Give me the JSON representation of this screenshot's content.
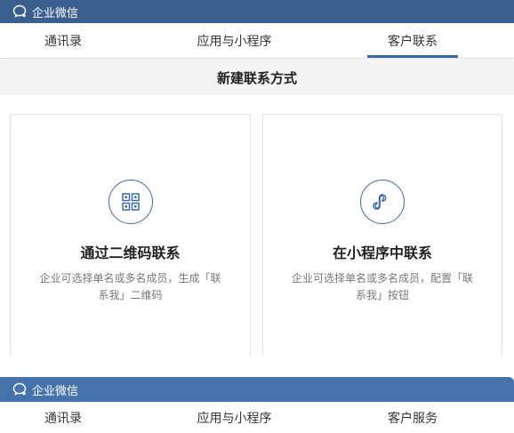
{
  "app": {
    "title": "企业微信"
  },
  "tabs_top": [
    {
      "label": "通讯录"
    },
    {
      "label": "应用与小程序"
    },
    {
      "label": "客户联系"
    }
  ],
  "section": {
    "title": "新建联系方式"
  },
  "cards": [
    {
      "title": "通过二维码联系",
      "desc": "企业可选择单名或多名成员，生成「联系我」二维码",
      "icon": "qrcode-icon"
    },
    {
      "title": "在小程序中联系",
      "desc": "企业可选择单名或多名成员，配置「联系我」按钮",
      "icon": "mini-program-icon"
    }
  ],
  "app2": {
    "title": "企业微信"
  },
  "tabs_bottom": [
    {
      "label": "通讯录"
    },
    {
      "label": "应用与小程序"
    },
    {
      "label": "客户服务"
    }
  ],
  "colors": {
    "titlebar": "#3a5f8f",
    "titlebar2": "#4673ac",
    "accent": "#3d68a8"
  }
}
